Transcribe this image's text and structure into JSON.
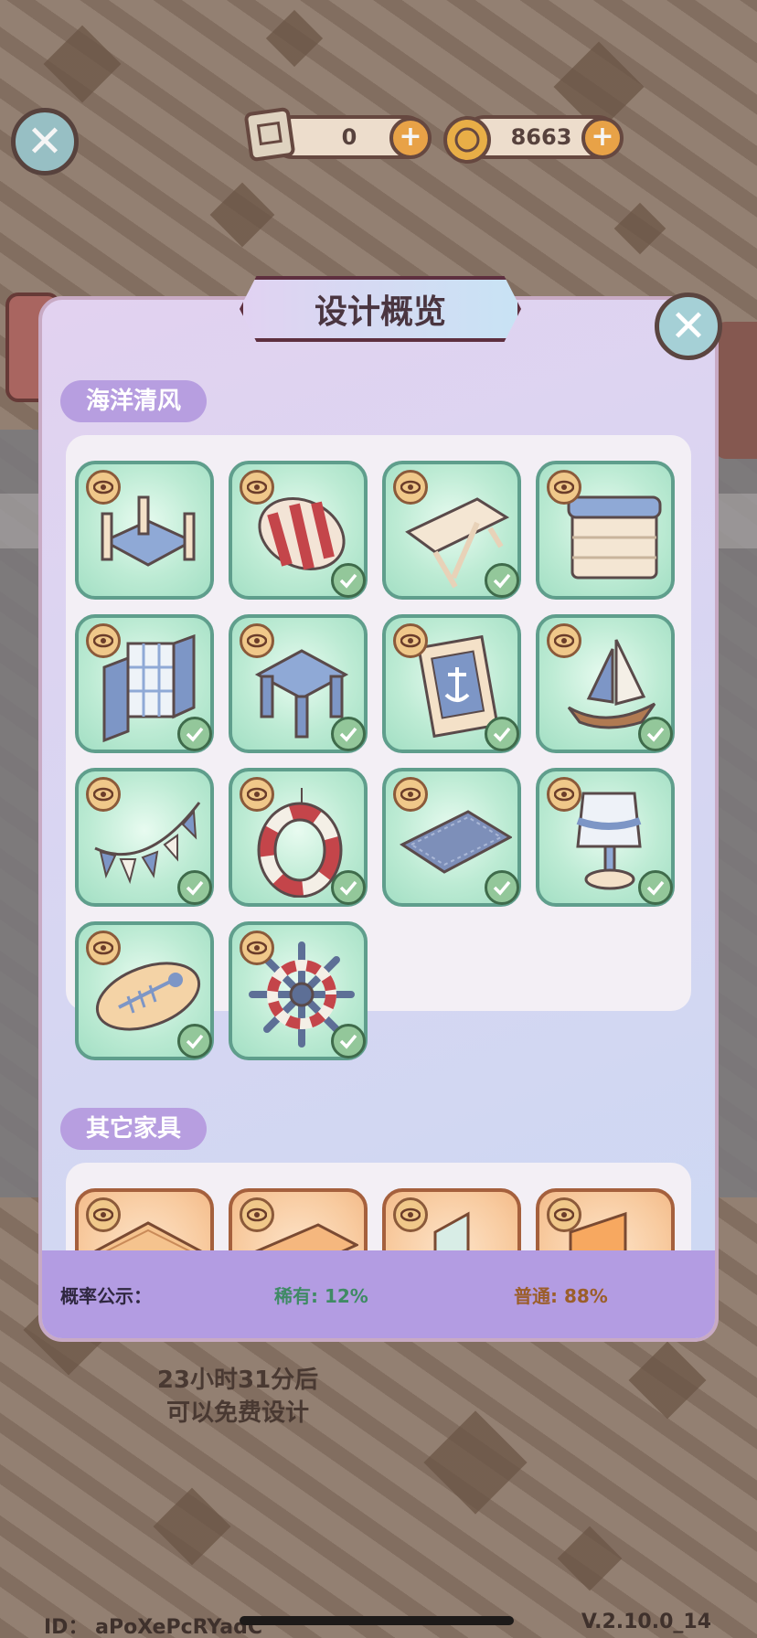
{
  "hud": {
    "blueprints": "0",
    "coins": "8663"
  },
  "background": {
    "cooldown_line1": "23小时31分后",
    "cooldown_line2": "可以免费设计",
    "user_id": "ID： aPoXePcRYadC",
    "version": "V.2.10.0_14"
  },
  "modal": {
    "title": "设计概览",
    "section1": {
      "label": "海洋清风",
      "items": [
        {
          "icon": "bed-icon",
          "owned": false
        },
        {
          "icon": "striped-pillow-icon",
          "owned": true
        },
        {
          "icon": "folding-table-icon",
          "owned": true
        },
        {
          "icon": "dresser-icon",
          "owned": false
        },
        {
          "icon": "window-shutter-icon",
          "owned": true
        },
        {
          "icon": "stool-icon",
          "owned": true
        },
        {
          "icon": "anchor-frame-icon",
          "owned": true
        },
        {
          "icon": "sailboat-icon",
          "owned": true
        },
        {
          "icon": "bunting-icon",
          "owned": true
        },
        {
          "icon": "life-ring-icon",
          "owned": true
        },
        {
          "icon": "rug-icon",
          "owned": true
        },
        {
          "icon": "fish-lamp-icon",
          "owned": true
        },
        {
          "icon": "fish-sign-icon",
          "owned": true
        },
        {
          "icon": "ship-wheel-icon",
          "owned": true
        }
      ]
    },
    "section2": {
      "label": "其它家具"
    },
    "probability": {
      "label": "概率公示：",
      "rare": "稀有: 12%",
      "common": "普通: 88%"
    }
  },
  "colors": {
    "accent_purple": "#b39ce2",
    "tile_green": "#bdebd4",
    "tile_orange": "#f8cba0"
  }
}
